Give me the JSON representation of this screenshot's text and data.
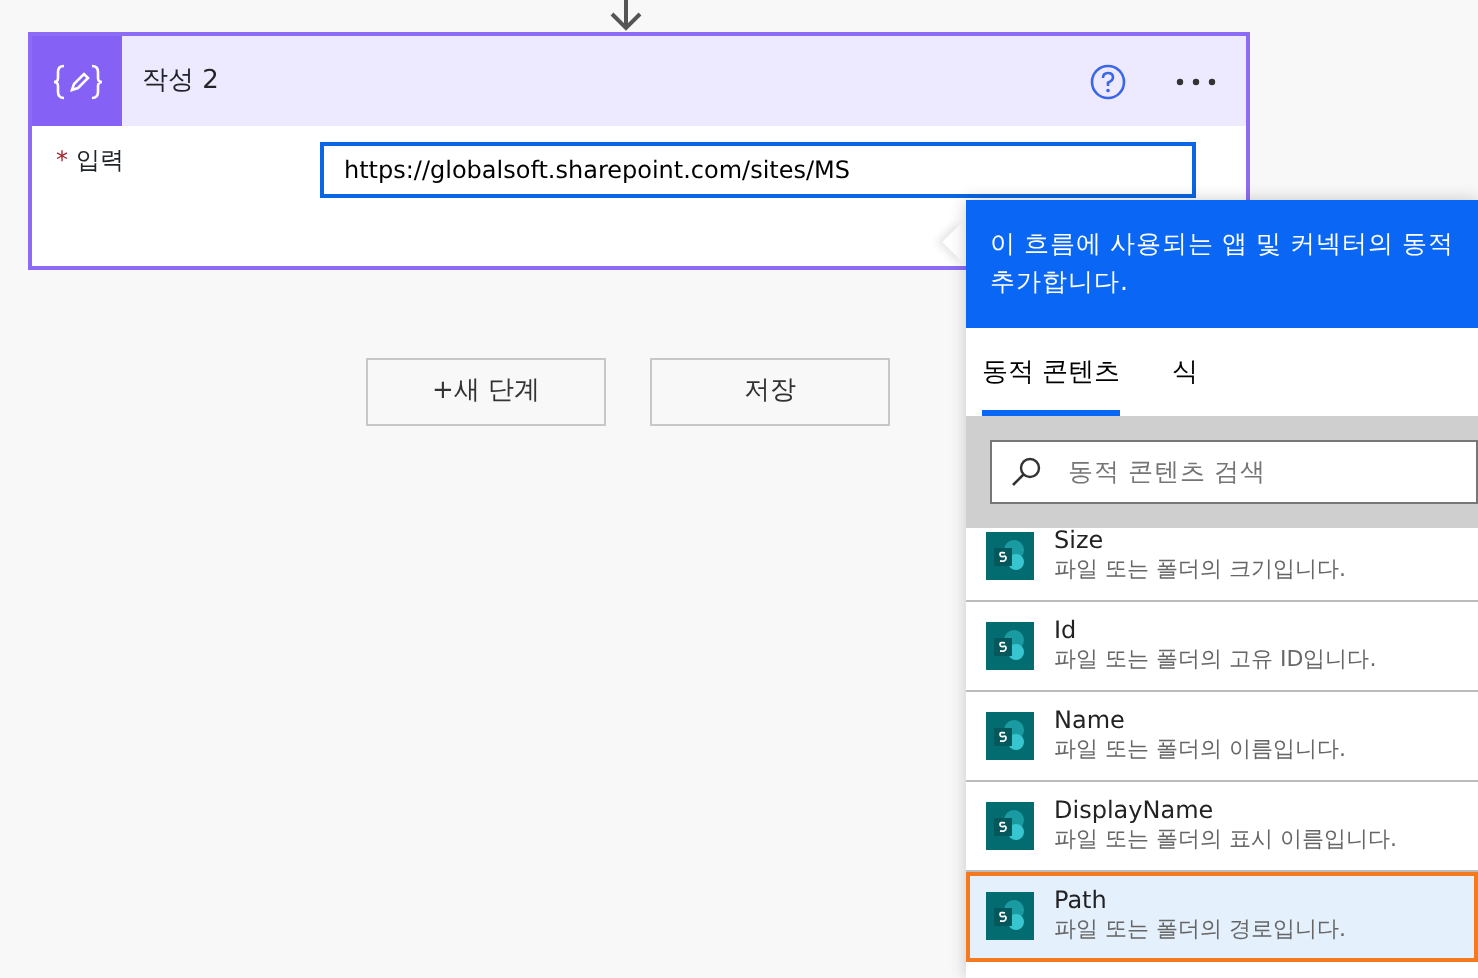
{
  "card": {
    "title": "작성 2",
    "fields": [
      {
        "label": "입력",
        "required_mark": "*",
        "value": "https://globalsoft.sharepoint.com/sites/MS"
      }
    ]
  },
  "buttons": [
    "+새 단계",
    "저장"
  ],
  "panel": {
    "banner": [
      "이 흐름에 사용되는 앱 및 커넥터의 동적",
      "추가합니다."
    ],
    "tabs": [
      {
        "label": "동적 콘텐츠",
        "selected": true
      },
      {
        "label": "식",
        "selected": false
      }
    ],
    "search": {
      "placeholder": "동적 콘텐츠 검색"
    },
    "items": [
      {
        "name": "Size",
        "description": "파일 또는 폴더의 크기입니다.",
        "selected": false
      },
      {
        "name": "Id",
        "description": "파일 또는 폴더의 고유 ID입니다.",
        "selected": false
      },
      {
        "name": "Name",
        "description": "파일 또는 폴더의 이름입니다.",
        "selected": false
      },
      {
        "name": "DisplayName",
        "description": "파일 또는 폴더의 표시 이름입니다.",
        "selected": false
      },
      {
        "name": "Path",
        "description": "파일 또는 폴더의 경로입니다.",
        "selected": true
      }
    ]
  }
}
